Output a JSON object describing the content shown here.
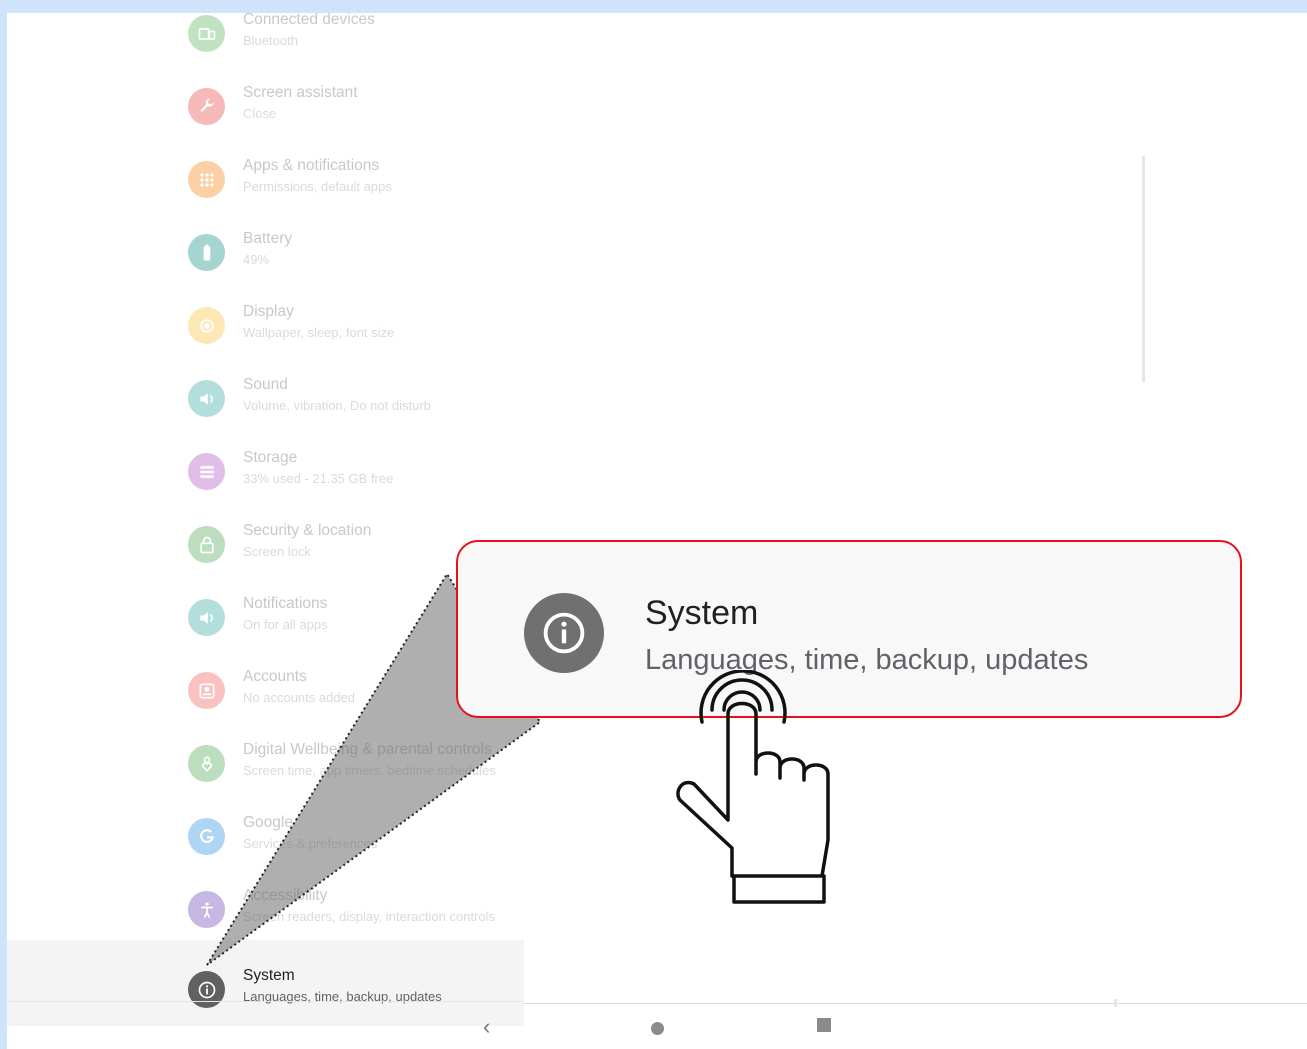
{
  "settings": {
    "items": [
      {
        "name": "connected-devices",
        "title": "Connected devices",
        "subtitle": "Bluetooth",
        "color": "#4caf50",
        "icon": "devices-icon"
      },
      {
        "name": "screen-assistant",
        "title": "Screen assistant",
        "subtitle": "Close",
        "color": "#e53935",
        "icon": "wrench-icon"
      },
      {
        "name": "apps-notifications",
        "title": "Apps & notifications",
        "subtitle": "Permissions, default apps",
        "color": "#f57c00",
        "icon": "apps-grid-icon"
      },
      {
        "name": "battery",
        "title": "Battery",
        "subtitle": "49%",
        "color": "#00897b",
        "icon": "battery-icon"
      },
      {
        "name": "display",
        "title": "Display",
        "subtitle": "Wallpaper, sleep, font size",
        "color": "#fbc02d",
        "icon": "brightness-icon"
      },
      {
        "name": "sound",
        "title": "Sound",
        "subtitle": "Volume, vibration, Do not disturb",
        "color": "#26a69a",
        "icon": "volume-icon"
      },
      {
        "name": "storage",
        "title": "Storage",
        "subtitle": "33% used - 21.35 GB free",
        "color": "#ab47bc",
        "icon": "storage-icon"
      },
      {
        "name": "security-location",
        "title": "Security & location",
        "subtitle": "Screen lock",
        "color": "#43a047",
        "icon": "lock-icon"
      },
      {
        "name": "notifications",
        "title": "Notifications",
        "subtitle": "On for all apps",
        "color": "#26a69a",
        "icon": "volume-icon"
      },
      {
        "name": "accounts",
        "title": "Accounts",
        "subtitle": "No accounts added",
        "color": "#ef5350",
        "icon": "account-icon"
      },
      {
        "name": "digital-wellbeing",
        "title": "Digital Wellbeing & parental controls",
        "subtitle": "Screen time, app timers, bedtime schedules",
        "color": "#43a047",
        "icon": "wellbeing-icon"
      },
      {
        "name": "google",
        "title": "Google",
        "subtitle": "Services & preferences",
        "color": "#1e88e5",
        "icon": "google-icon"
      },
      {
        "name": "accessibility",
        "title": "Accessibility",
        "subtitle": "Screen readers, display, interaction controls",
        "color": "#5e35b1",
        "icon": "accessibility-icon"
      },
      {
        "name": "system",
        "title": "System",
        "subtitle": "Languages, time, backup, updates",
        "color": "#616161",
        "icon": "info-icon",
        "selected": true
      }
    ]
  },
  "callout": {
    "title": "System",
    "subtitle": "Languages, time, backup, updates",
    "border_color": "#e3131b"
  },
  "navbar": {
    "back": "‹"
  }
}
